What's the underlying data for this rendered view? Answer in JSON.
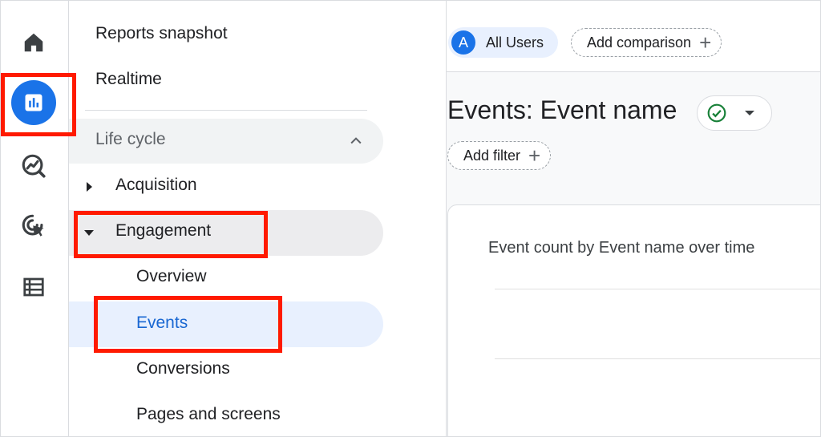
{
  "rail": {
    "items": [
      {
        "icon": "home-icon"
      },
      {
        "icon": "reports-icon",
        "active": true
      },
      {
        "icon": "explore-icon"
      },
      {
        "icon": "advertising-icon"
      },
      {
        "icon": "configure-icon"
      }
    ]
  },
  "nav": {
    "reports_snapshot": "Reports snapshot",
    "realtime": "Realtime",
    "section": "Life cycle",
    "acquisition": "Acquisition",
    "engagement": "Engagement",
    "overview": "Overview",
    "events": "Events",
    "conversions": "Conversions",
    "pages_and_screens": "Pages and screens"
  },
  "topbar": {
    "avatar_letter": "A",
    "all_users": "All Users",
    "add_comparison": "Add comparison"
  },
  "main": {
    "title": "Events: Event name",
    "add_filter": "Add filter",
    "card_title": "Event count by Event name over time"
  },
  "colors": {
    "accent": "#1a73e8",
    "highlight": "#ff1a00",
    "active_bg": "#e8f0fe",
    "check": "#188038"
  }
}
